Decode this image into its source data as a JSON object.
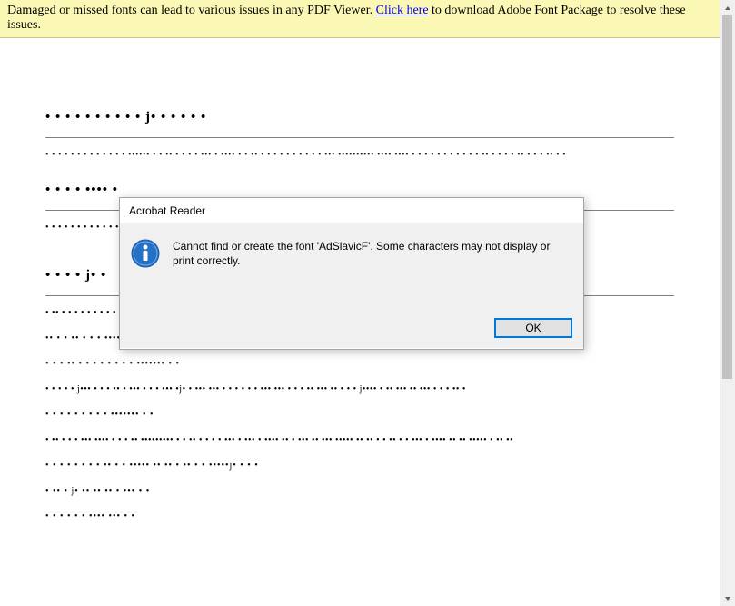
{
  "banner": {
    "text_before": "Damaged or missed fonts can lead to various issues in any PDF Viewer. ",
    "link_text": "Click here",
    "text_after": " to download Adobe Font Package to resolve these issues."
  },
  "document": {
    "lines": [
      "• •  • • • • •   • • • j• • • • • •",
      "• • • •  • • • • • • • • •  ••••••  • • •• • •  • • ••• • •••• • • •• • • • • • • • • • • ••• •••••••••• •••• •••• • • • • • •  • • • • • ••  • • • • •• • • • ••  • •",
      "• • •  • •••• •",
      "",
      "• • • •  • • • • • • • •  •• •••••• •••• • •••• • •• • • ••• • ••••• •• ••••••  • •  •••••  • •• •  • •••  ••• • •  • • • ••• • •• •• • • •• • • •••  • •• • • • ••",
      "",
      "•  • • • j• •",
      "",
      "• •• • • • • • • • • • ••  •  ••  • • • •  ••  • • •• • •  •• • • • ••• • • • • • • • • ••  •  • ••• • • • • • • • • • • • • • • ••  • •• • • •• • • • •• • •  • • • • • • •",
      "•• • • •• • • • •••• • •  ••• • •• •• • • • • ••  •  • •",
      "• • •  •• • • • • • • • •  ••••••• • •",
      "• • • •  • j••• • •  • •• • ••• • • • ••• •j• •  ••• ••• • •  • • • • ••• ••• • • • •• ••• ••  •  • • j•••• • ••  •••  •• ••• • • • •• •",
      "• •   • • • • • • •   ••••••• • •",
      "• •• • • • ••• ••••  • • •  •• ••••••••• •  •  ••  • • • • ••• • ••• • •••• •• • ••• ••  ••• ••••• •• ••  •  • •• •  • ••• • •••• •• •• ••••• • •• ••",
      "• • • • • • • •  •• • • •••••  •• •• • •• • •  •••••j• • • •",
      "• •• • j• •• •• •• • ••• • •",
      "• • •  • •  • •••• ••• • •"
    ]
  },
  "dialog": {
    "title": "Acrobat Reader",
    "message": "Cannot find or create the font 'AdSlavicF'. Some characters may not display or print correctly.",
    "ok_label": "OK"
  }
}
